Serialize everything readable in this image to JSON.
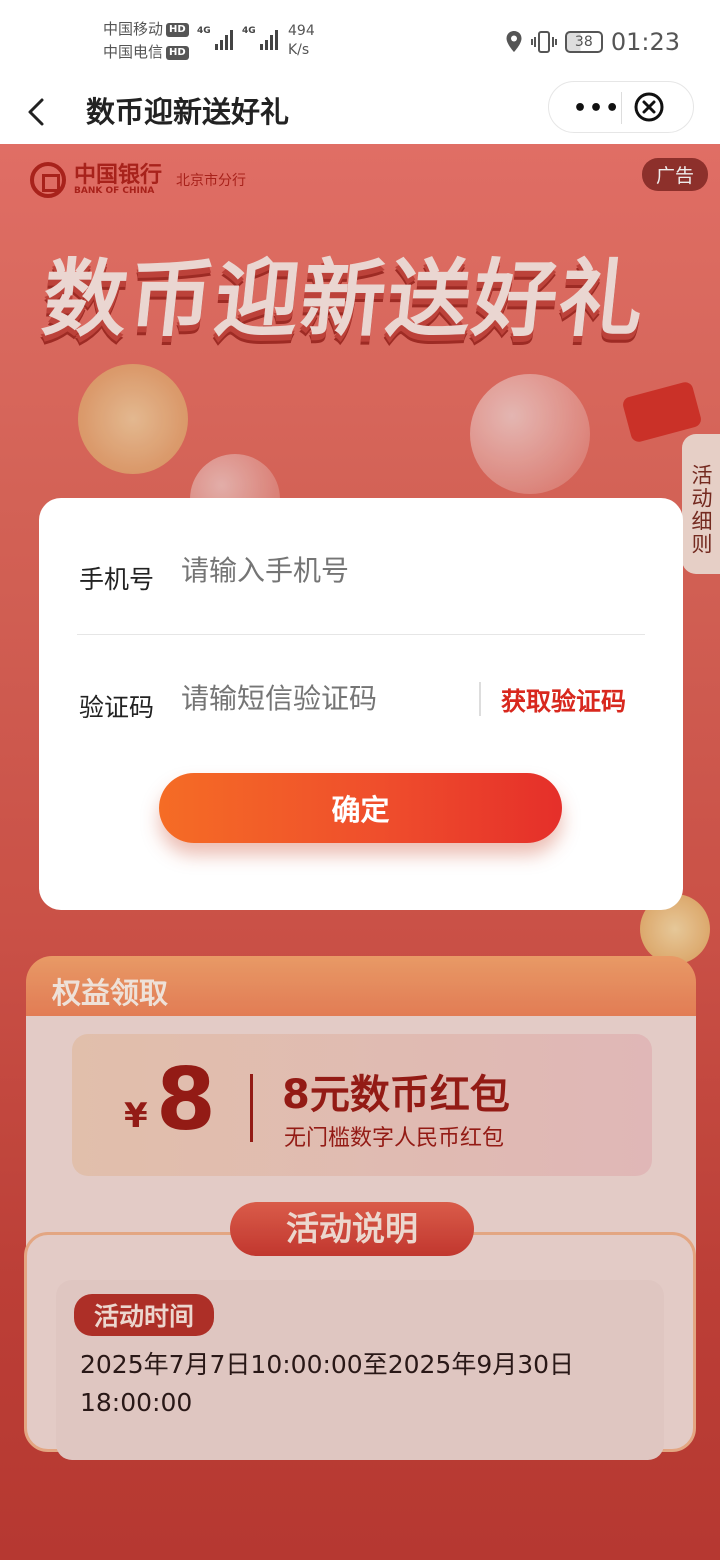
{
  "status_bar": {
    "carrier1": "中国移动",
    "carrier2": "中国电信",
    "hd": "HD",
    "net1": "4G",
    "net2": "4G",
    "speed_value": "494",
    "speed_unit": "K/s",
    "battery": "38",
    "time": "01:23"
  },
  "nav": {
    "title": "数币迎新送好礼",
    "more": "•••"
  },
  "banner": {
    "bank_name_cn": "中国银行",
    "bank_name_en": "BANK OF CHINA",
    "branch": "北京市分行",
    "ad_tag": "广告",
    "hero_title": "数币迎新送好礼",
    "side_tab": "活动细则"
  },
  "dialog": {
    "phone_label": "手机号",
    "phone_placeholder": "请输入手机号",
    "code_label": "验证码",
    "code_placeholder": "请输短信验证码",
    "get_code": "获取验证码",
    "confirm": "确定"
  },
  "benefits": {
    "title": "权益领取",
    "coupon": {
      "currency": "¥",
      "amount": "8",
      "name": "8元数币红包",
      "desc": "无门槛数字人民币红包"
    }
  },
  "rules": {
    "title": "活动说明",
    "time_tag": "活动时间",
    "time_text": "2025年7月7日10:00:00至2025年9月30日18:00:00"
  }
}
